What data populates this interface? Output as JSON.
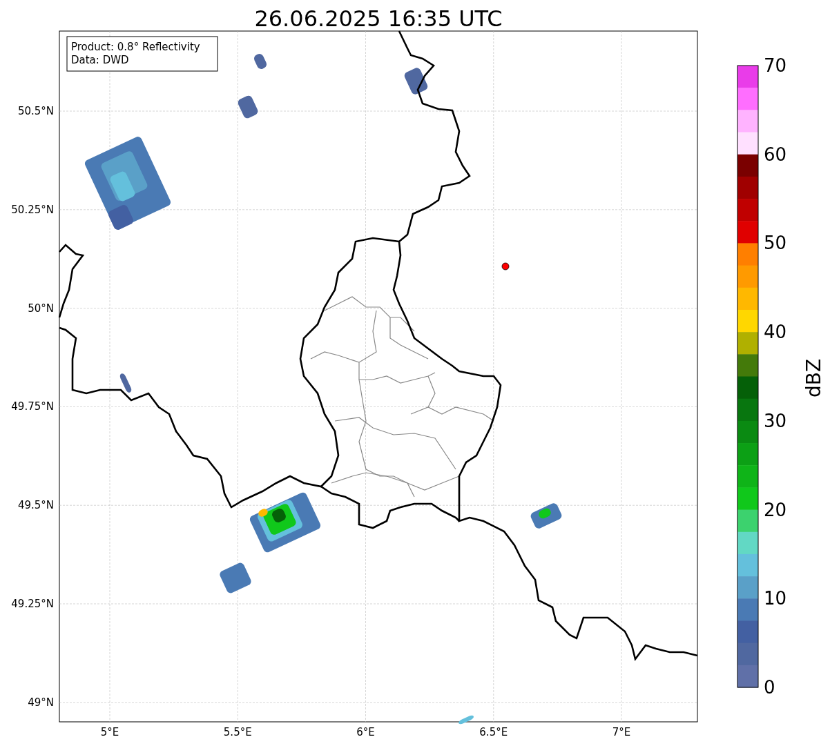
{
  "title": "26.06.2025 16:35 UTC",
  "info_box": {
    "lines": [
      "Product: 0.8° Reflectivity",
      "Data: DWD"
    ]
  },
  "map": {
    "x_ticks": [
      "5°E",
      "5.5°E",
      "6°E",
      "6.5°E",
      "7°E"
    ],
    "y_ticks": [
      "50.5°N",
      "50.25°N",
      "50°N",
      "49.75°N",
      "49.5°N",
      "49.25°N",
      "49°N"
    ]
  },
  "colorbar": {
    "label": "dBZ",
    "ticks": [
      "70",
      "60",
      "50",
      "40",
      "30",
      "20",
      "10",
      "0"
    ],
    "segments": [
      {
        "color": "#e93ce9"
      },
      {
        "color": "#ff6eff"
      },
      {
        "color": "#ffb3ff"
      },
      {
        "color": "#ffe0ff"
      },
      {
        "color": "#7a0000"
      },
      {
        "color": "#a00000"
      },
      {
        "color": "#c00000"
      },
      {
        "color": "#e00000"
      },
      {
        "color": "#ff7f00"
      },
      {
        "color": "#ff9a00"
      },
      {
        "color": "#ffb800"
      },
      {
        "color": "#ffd700"
      },
      {
        "color": "#b0b000"
      },
      {
        "color": "#447a0a"
      },
      {
        "color": "#056008"
      },
      {
        "color": "#08760f"
      },
      {
        "color": "#0a8a12"
      },
      {
        "color": "#0ca015"
      },
      {
        "color": "#0fb418"
      },
      {
        "color": "#10c81b"
      },
      {
        "color": "#3cd26e"
      },
      {
        "color": "#62d8c4"
      },
      {
        "color": "#64c0dc"
      },
      {
        "color": "#5aa0c8"
      },
      {
        "color": "#4a7ab4"
      },
      {
        "color": "#4360a2"
      },
      {
        "color": "#5068a0"
      },
      {
        "color": "#6070a8"
      }
    ]
  }
}
